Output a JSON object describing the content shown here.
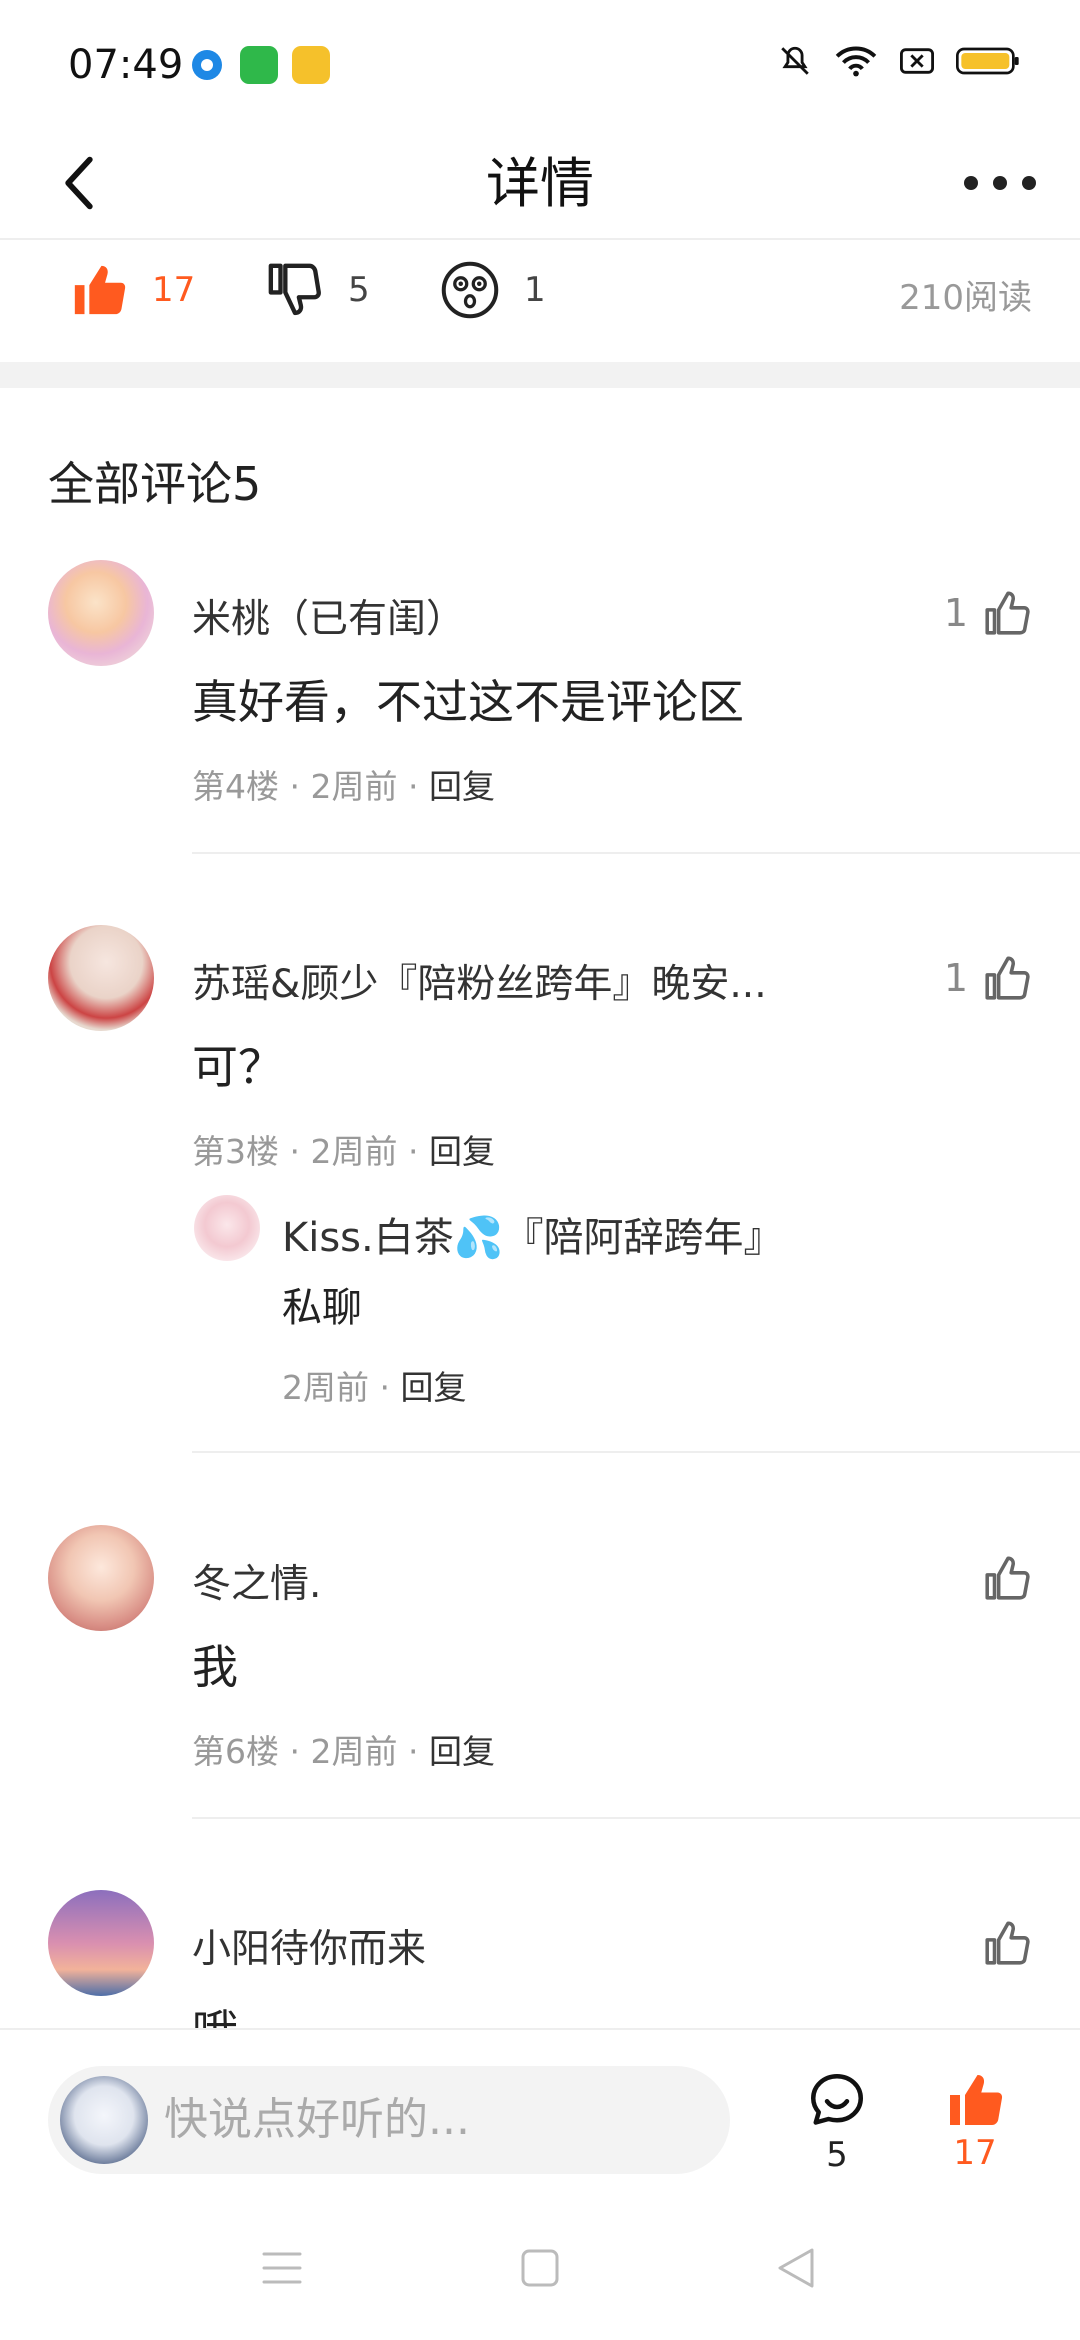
{
  "status_bar": {
    "time": "07:49",
    "icons": [
      "app-blue-icon",
      "app-green-icon",
      "app-yellow-icon",
      "mute-icon",
      "wifi-icon",
      "sim-off-icon",
      "battery-icon"
    ]
  },
  "header": {
    "title": "详情",
    "back_icon": "chevron-left-icon",
    "more_icon": "more-dots-icon"
  },
  "reactions": {
    "like_count": "17",
    "dislike_count": "5",
    "dizzy_count": "1",
    "reads": "210阅读",
    "accent_color": "#ff5a1f"
  },
  "comments_section": {
    "title": "全部评论5",
    "reply_label": "回复",
    "items": [
      {
        "name": "米桃（已有闺）",
        "text": "真好看，不过这不是评论区",
        "meta": "第4楼 · 2周前 · ",
        "likes": "1"
      },
      {
        "name": "苏瑶&顾少『陪粉丝跨年』晚安...",
        "text": "可？",
        "meta": "第3楼 · 2周前 · ",
        "likes": "1",
        "sub_reply": {
          "name": "Kiss.白茶💦『陪阿辞跨年』",
          "text": "私聊",
          "meta": "2周前 · "
        }
      },
      {
        "name": "冬之情.",
        "text": "我",
        "meta": "第6楼 · 2周前 · ",
        "likes": ""
      },
      {
        "name": "小阳待你而来",
        "text": "哦",
        "meta": "",
        "likes": ""
      }
    ]
  },
  "bottom_bar": {
    "input_placeholder": "快说点好听的...",
    "comment_count": "5",
    "like_count": "17"
  },
  "nav_bar": {
    "icons": [
      "menu-icon",
      "home-square-icon",
      "back-triangle-icon"
    ]
  }
}
